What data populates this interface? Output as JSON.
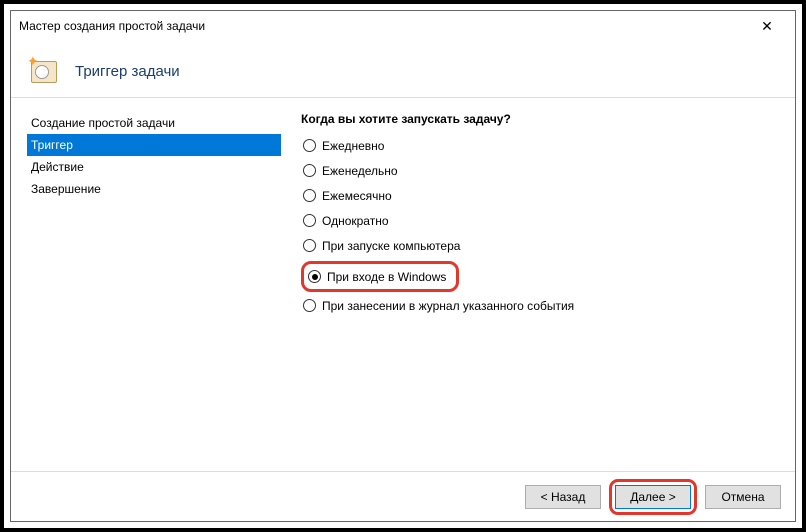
{
  "titlebar": {
    "text": "Мастер создания простой задачи"
  },
  "header": {
    "title": "Триггер задачи"
  },
  "sidebar": {
    "items": [
      {
        "label": "Создание простой задачи",
        "selected": false
      },
      {
        "label": "Триггер",
        "selected": true
      },
      {
        "label": "Действие",
        "selected": false
      },
      {
        "label": "Завершение",
        "selected": false
      }
    ]
  },
  "main": {
    "question": "Когда вы хотите запускать задачу?",
    "options": [
      {
        "label": "Ежедневно",
        "checked": false
      },
      {
        "label": "Еженедельно",
        "checked": false
      },
      {
        "label": "Ежемесячно",
        "checked": false
      },
      {
        "label": "Однократно",
        "checked": false
      },
      {
        "label": "При запуске компьютера",
        "checked": false
      },
      {
        "label": "При входе в Windows",
        "checked": true
      },
      {
        "label": "При занесении в журнал указанного события",
        "checked": false
      }
    ]
  },
  "footer": {
    "back": "< Назад",
    "next": "Далее >",
    "cancel": "Отмена"
  }
}
